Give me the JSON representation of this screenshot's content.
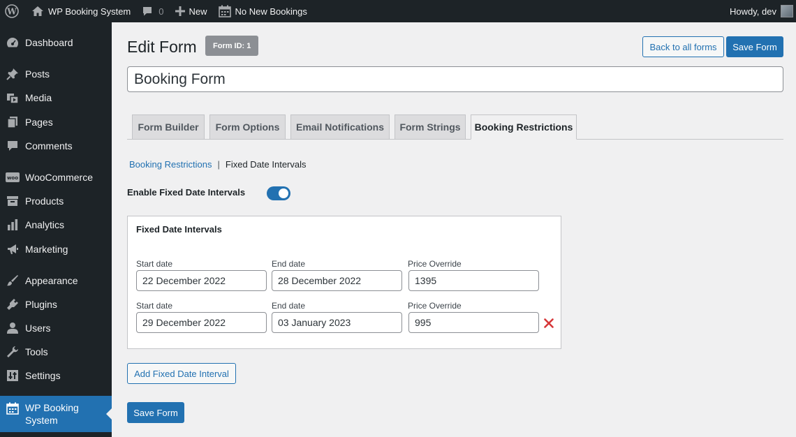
{
  "adminbar": {
    "site_name": "WP Booking System",
    "comments_count": "0",
    "new_label": "New",
    "bookings_label": "No New Bookings",
    "howdy": "Howdy, dev"
  },
  "sidebar": {
    "items": [
      {
        "label": "Dashboard",
        "icon": "dashboard-icon"
      },
      {
        "label": "Posts",
        "icon": "pin-icon"
      },
      {
        "label": "Media",
        "icon": "media-icon"
      },
      {
        "label": "Pages",
        "icon": "pages-icon"
      },
      {
        "label": "Comments",
        "icon": "comment-icon"
      },
      {
        "label": "WooCommerce",
        "icon": "woo-icon"
      },
      {
        "label": "Products",
        "icon": "archive-icon"
      },
      {
        "label": "Analytics",
        "icon": "bar-chart-icon"
      },
      {
        "label": "Marketing",
        "icon": "megaphone-icon"
      },
      {
        "label": "Appearance",
        "icon": "brush-icon"
      },
      {
        "label": "Plugins",
        "icon": "plugin-icon"
      },
      {
        "label": "Users",
        "icon": "user-icon"
      },
      {
        "label": "Tools",
        "icon": "wrench-icon"
      },
      {
        "label": "Settings",
        "icon": "settings-icon"
      },
      {
        "label_line1": "WP Booking",
        "label_line2": "System",
        "icon": "calendar-icon"
      }
    ]
  },
  "header": {
    "title": "Edit Form",
    "form_id": "Form ID: 1",
    "back_button": "Back to all forms",
    "save_button": "Save Form"
  },
  "form_title": "Booking Form",
  "tabs": [
    {
      "label": "Form Builder"
    },
    {
      "label": "Form Options"
    },
    {
      "label": "Email Notifications"
    },
    {
      "label": "Form Strings"
    },
    {
      "label": "Booking Restrictions"
    }
  ],
  "breadcrumb": {
    "link": "Booking Restrictions",
    "separator": "|",
    "current": "Fixed Date Intervals"
  },
  "toggle": {
    "label": "Enable Fixed Date Intervals",
    "enabled": true
  },
  "intervals_panel": {
    "title": "Fixed Date Intervals",
    "start_label": "Start date",
    "end_label": "End date",
    "price_label": "Price Override",
    "rows": [
      {
        "start": "22 December 2022",
        "end": "28 December 2022",
        "price": "1395"
      },
      {
        "start": "29 December 2022",
        "end": "03 January 2023",
        "price": "995"
      }
    ]
  },
  "add_interval_button": "Add Fixed Date Interval",
  "save_form_bottom": "Save Form",
  "colors": {
    "accent": "#2271b1",
    "sidebar_bg": "#1d2327",
    "remove": "#d63638"
  }
}
